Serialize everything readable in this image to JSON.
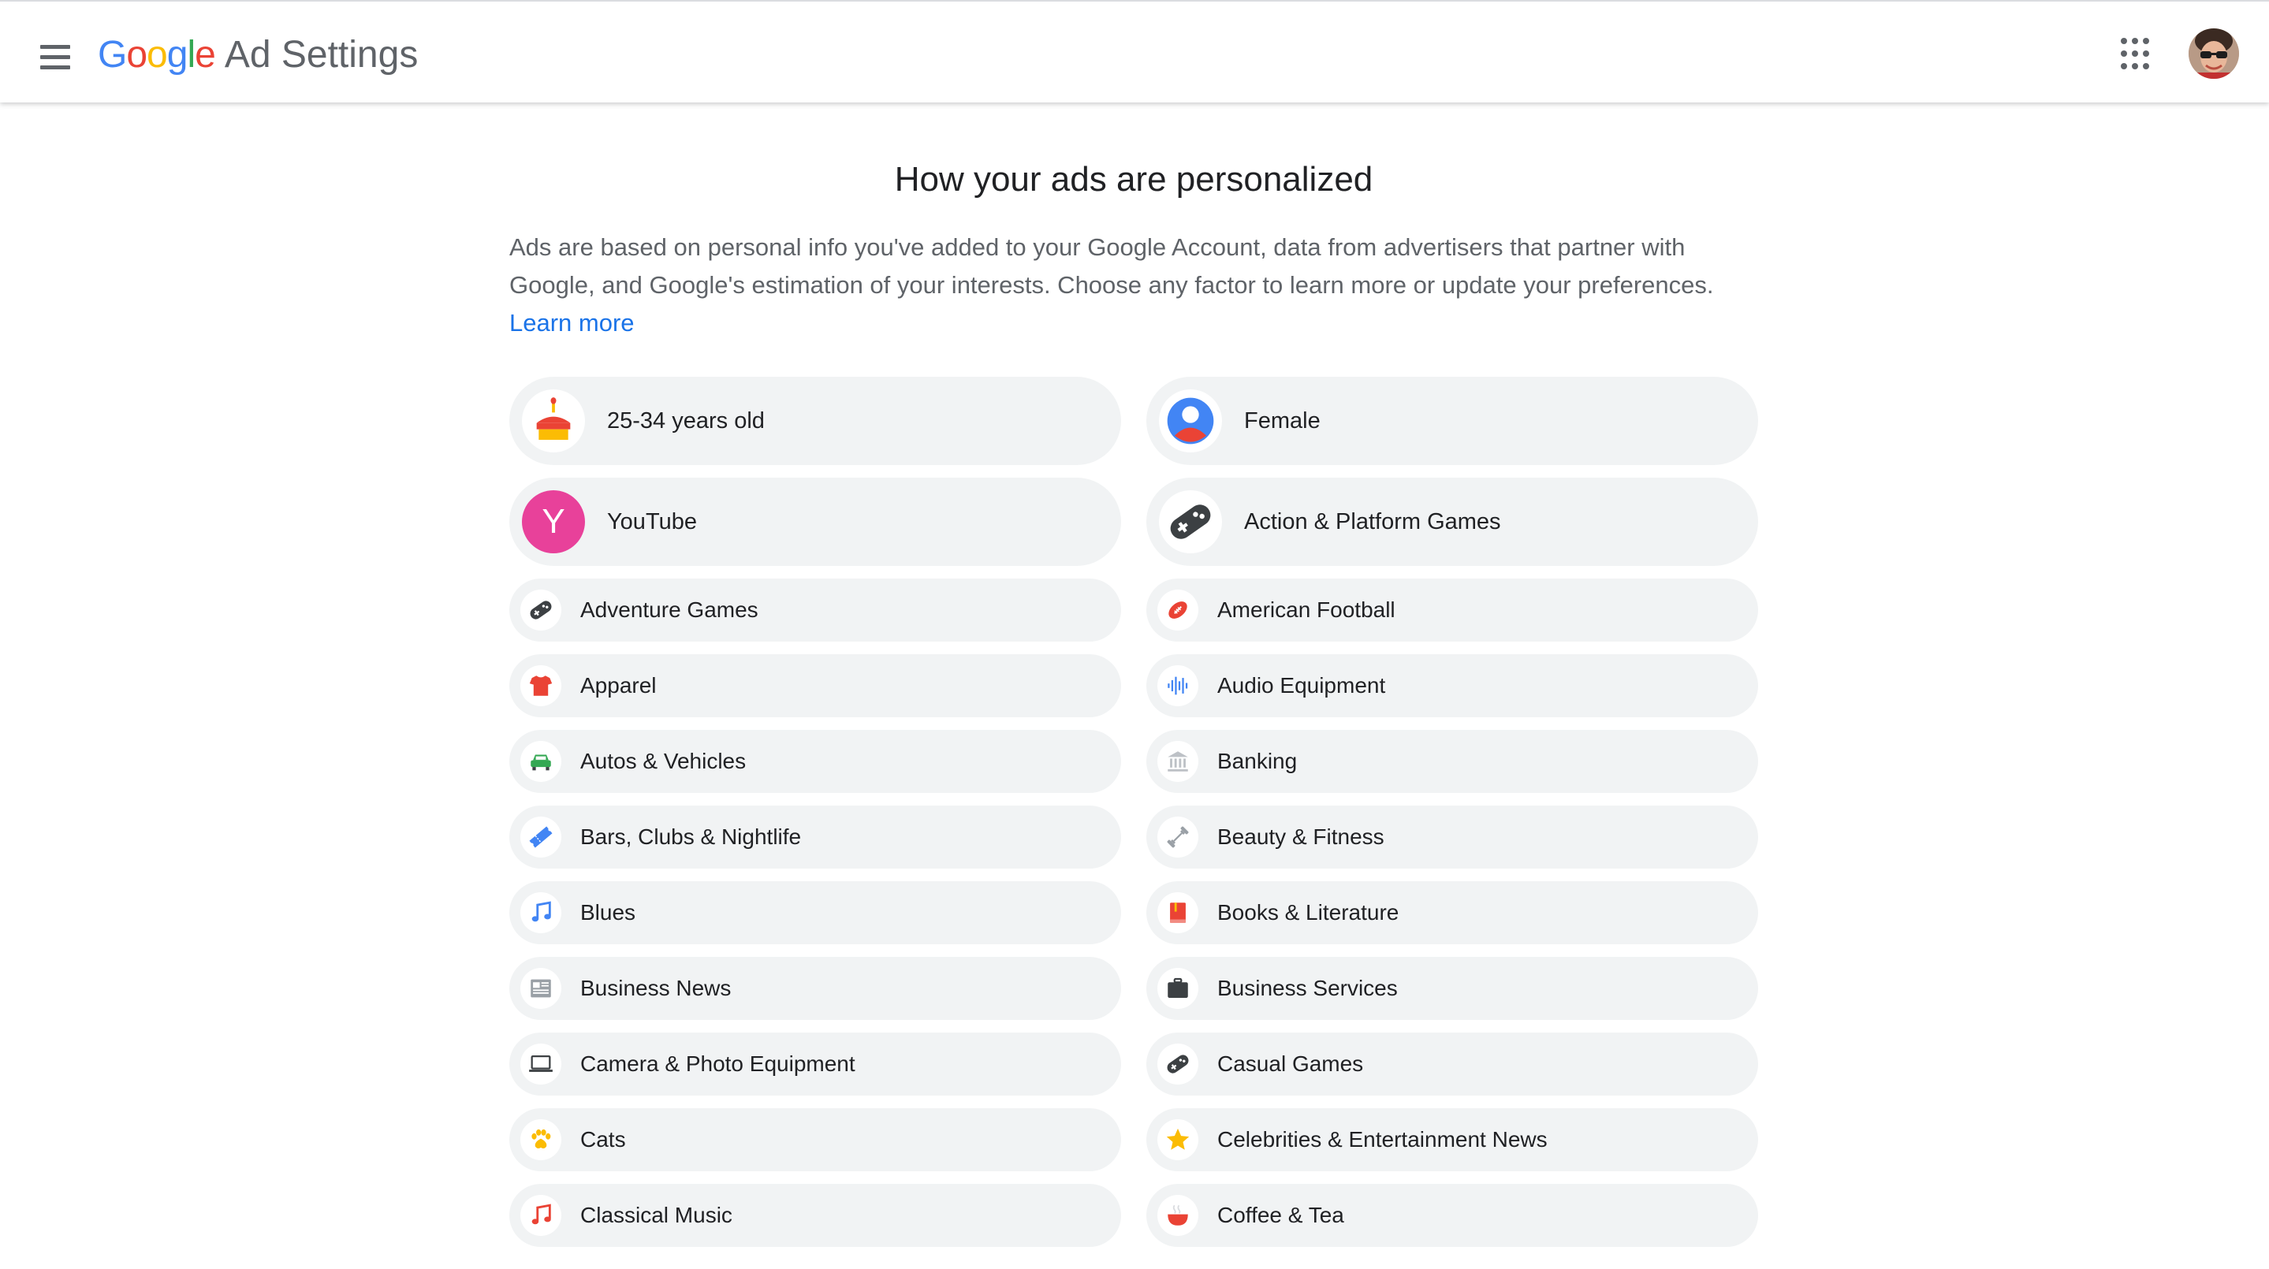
{
  "header": {
    "logo_letters": [
      {
        "ch": "G",
        "color": "#4285F4"
      },
      {
        "ch": "o",
        "color": "#EA4335"
      },
      {
        "ch": "o",
        "color": "#FBBC05"
      },
      {
        "ch": "g",
        "color": "#4285F4"
      },
      {
        "ch": "l",
        "color": "#34A853"
      },
      {
        "ch": "e",
        "color": "#EA4335"
      }
    ],
    "product_name": "Ad Settings",
    "menu_icon": "hamburger-menu-icon",
    "apps_icon": "apps-grid-icon",
    "avatar_icon": "account-avatar"
  },
  "main": {
    "title": "How your ads are personalized",
    "intro_text": "Ads are based on personal info you've added to your Google Account, data from advertisers that partner with Google, and Google's estimation of your interests. Choose any factor to learn more or update your preferences.",
    "learn_more": "Learn more"
  },
  "factors": [
    {
      "label": "25-34 years old",
      "icon": "birthday-cake-icon",
      "size": "big",
      "col": 0,
      "row": 0
    },
    {
      "label": "Female",
      "icon": "person-icon",
      "size": "big",
      "col": 1,
      "row": 0
    },
    {
      "label": "YouTube",
      "icon": "letter-y-icon",
      "letter": "Y",
      "size": "big",
      "col": 0,
      "row": 1
    },
    {
      "label": "Action & Platform Games",
      "icon": "gamepad-icon",
      "size": "big",
      "col": 1,
      "row": 1
    },
    {
      "label": "Adventure Games",
      "icon": "gamepad-icon",
      "size": "small",
      "col": 0,
      "row": 0
    },
    {
      "label": "American Football",
      "icon": "football-icon",
      "size": "small",
      "col": 1,
      "row": 0
    },
    {
      "label": "Apparel",
      "icon": "shirt-icon",
      "size": "small",
      "col": 0,
      "row": 1
    },
    {
      "label": "Audio Equipment",
      "icon": "audio-waveform-icon",
      "size": "small",
      "col": 1,
      "row": 1
    },
    {
      "label": "Autos & Vehicles",
      "icon": "car-icon",
      "size": "small",
      "col": 0,
      "row": 2
    },
    {
      "label": "Banking",
      "icon": "bank-icon",
      "size": "small",
      "col": 1,
      "row": 2
    },
    {
      "label": "Bars, Clubs & Nightlife",
      "icon": "ticket-icon",
      "size": "small",
      "col": 0,
      "row": 3
    },
    {
      "label": "Beauty & Fitness",
      "icon": "dumbbell-icon",
      "size": "small",
      "col": 1,
      "row": 3
    },
    {
      "label": "Blues",
      "icon": "music-note-icon",
      "size": "small",
      "col": 0,
      "row": 4
    },
    {
      "label": "Books & Literature",
      "icon": "book-icon",
      "size": "small",
      "col": 1,
      "row": 4
    },
    {
      "label": "Business News",
      "icon": "newspaper-icon",
      "size": "small",
      "col": 0,
      "row": 5
    },
    {
      "label": "Business Services",
      "icon": "briefcase-icon",
      "size": "small",
      "col": 1,
      "row": 5
    },
    {
      "label": "Camera & Photo Equipment",
      "icon": "laptop-icon",
      "size": "small",
      "col": 0,
      "row": 6
    },
    {
      "label": "Casual Games",
      "icon": "gamepad-icon",
      "size": "small",
      "col": 1,
      "row": 6
    },
    {
      "label": "Cats",
      "icon": "paw-icon",
      "size": "small",
      "col": 0,
      "row": 7
    },
    {
      "label": "Celebrities & Entertainment News",
      "icon": "star-icon",
      "size": "small",
      "col": 1,
      "row": 7
    },
    {
      "label": "Classical Music",
      "icon": "music-note-icon",
      "size": "small",
      "col": 0,
      "row": 8
    },
    {
      "label": "Coffee & Tea",
      "icon": "coffee-cup-icon",
      "size": "small",
      "col": 1,
      "row": 8
    }
  ],
  "colors": {
    "chip_bg": "#f1f3f4",
    "link": "#1a73e8",
    "youtube_circle": "#e8419a",
    "icon_red": "#ea4335",
    "icon_blue": "#4285f4",
    "icon_green": "#34a853",
    "icon_yellow": "#fbbc04",
    "icon_dark": "#3c4043"
  }
}
